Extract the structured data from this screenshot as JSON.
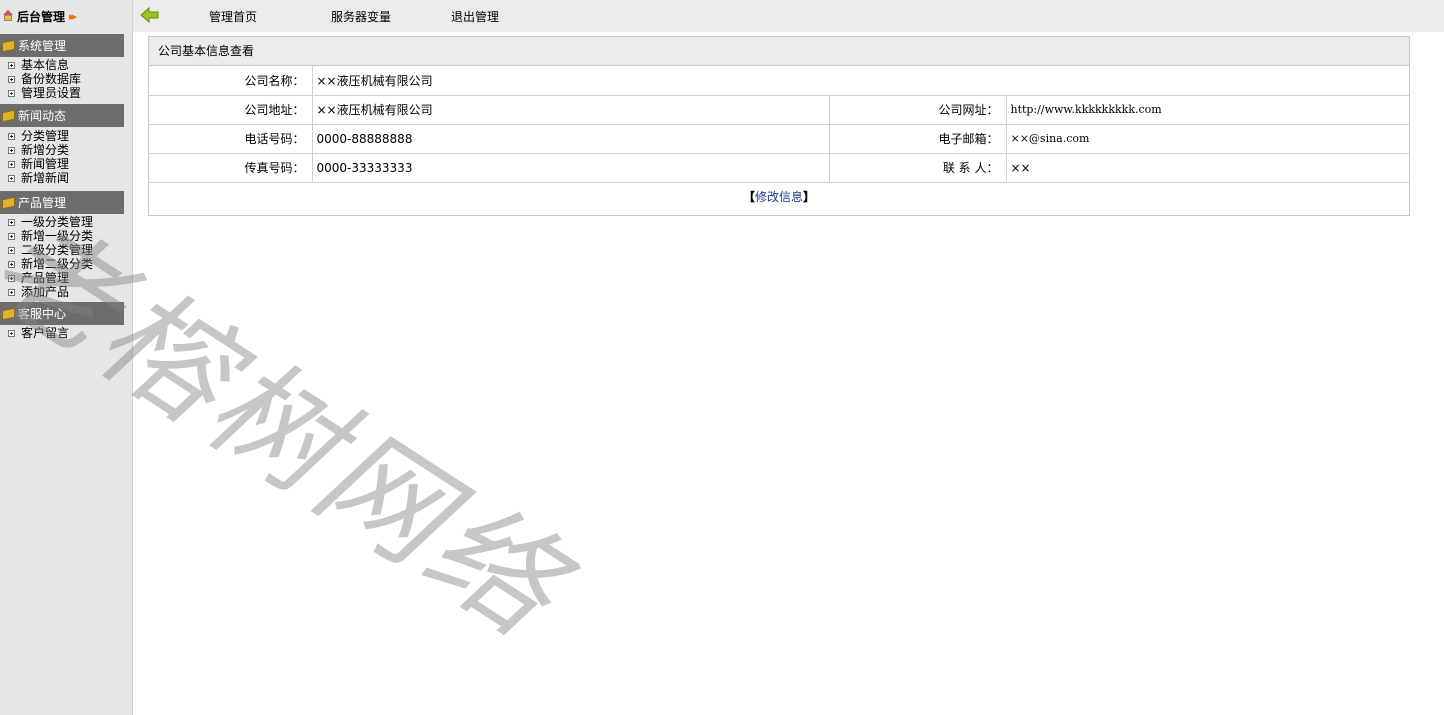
{
  "brand": {
    "title": "后台管理",
    "arrows": "▸▸"
  },
  "sidebar": {
    "sections": [
      {
        "title": "系统管理",
        "items": [
          "基本信息",
          "备份数据库",
          "管理员设置"
        ]
      },
      {
        "title": "新闻动态",
        "items": [
          "分类管理",
          "新增分类",
          "新闻管理",
          "新增新闻"
        ]
      },
      {
        "title": "产品管理",
        "items": [
          "一级分类管理",
          "新增一级分类",
          "二级分类管理",
          "新增二级分类",
          "产品管理",
          "添加产品"
        ]
      },
      {
        "title": "客服中心",
        "items": [
          "客户留言"
        ]
      }
    ]
  },
  "topnav": {
    "links": [
      "管理首页",
      "服务器变量",
      "退出管理"
    ]
  },
  "panel": {
    "title": "公司基本信息查看",
    "rows": {
      "company_name_label": "公司名称：",
      "company_name": "××液压机械有限公司",
      "address_label": "公司地址：",
      "address": "××液压机械有限公司",
      "website_label": "公司网址：",
      "website": "http://www.kkkkkkkkk.com",
      "phone_label": "电话号码：",
      "phone": "0000-88888888",
      "email_label": "电子邮箱：",
      "email": "××@sina.com",
      "fax_label": "传真号码：",
      "fax": "0000-33333333",
      "contact_label": "联 系 人：",
      "contact": "××"
    },
    "edit_open": "【",
    "edit_label": "修改信息",
    "edit_close": "】"
  },
  "watermark": "老榕树网络",
  "colors": {
    "sidebar_header": "#6d6d6d",
    "link": "#1a3b8a",
    "back_arrow": "#9bc324"
  }
}
